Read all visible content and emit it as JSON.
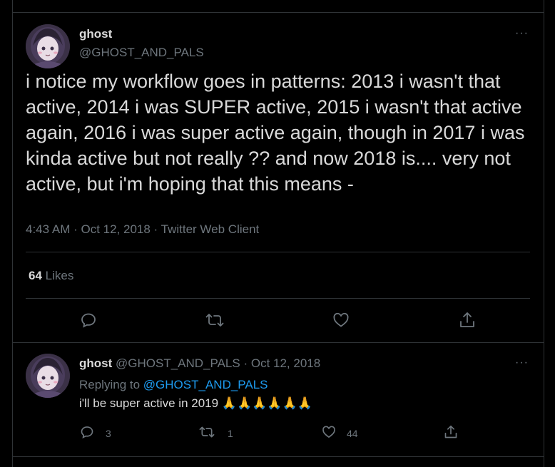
{
  "tweet": {
    "author_name": "ghost",
    "author_handle": "@GHOST_AND_PALS",
    "text": "i notice my workflow goes in patterns: 2013 i wasn't that active, 2014 i was SUPER active, 2015 i wasn't that active again, 2016 i was super active again, though in 2017 i was kinda active but not really ?? and now 2018 is.... very not active, but i'm hoping that this means -",
    "time": "4:43 AM",
    "date": "Oct 12, 2018",
    "source": "Twitter Web Client",
    "separator": " · ",
    "likes_count": "64",
    "likes_label": "Likes",
    "more_label": "···"
  },
  "reply": {
    "author_name": "ghost",
    "author_handle": "@GHOST_AND_PALS",
    "date": "Oct 12, 2018",
    "separator": " · ",
    "replying_label": "Replying to",
    "replying_to": "@GHOST_AND_PALS",
    "text": "i'll be super active in 2019",
    "emoji": "🙏🙏🙏🙏🙏🙏",
    "reply_count": "3",
    "retweet_count": "1",
    "like_count": "44",
    "more_label": "···"
  },
  "icons": {
    "reply": "reply-icon",
    "retweet": "retweet-icon",
    "like": "heart-icon",
    "share": "share-icon",
    "more": "more-icon"
  },
  "colors": {
    "background": "#000000",
    "text": "#d9d9d9",
    "muted": "#6e767d",
    "border": "#2f3336",
    "accent": "#1d9bf0"
  }
}
